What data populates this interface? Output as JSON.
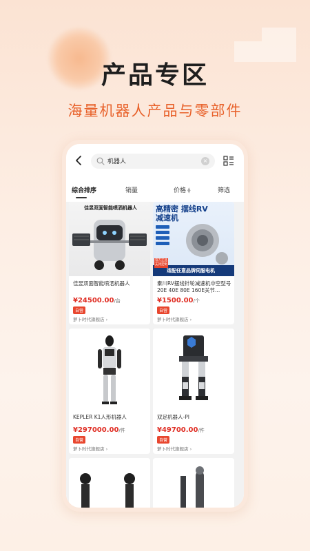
{
  "promo": {
    "title": "产品专区",
    "subtitle": "海量机器人产品与零部件"
  },
  "search": {
    "value": "机器人"
  },
  "sort_tabs": [
    "综合排序",
    "销量",
    "价格",
    "筛选"
  ],
  "products": [
    {
      "name": "佳昱双面智能喷洒机器人",
      "price": "¥24500.00",
      "unit": "/台",
      "badge": "自营",
      "store": "萝卜时代旗舰店 ›",
      "image_caption": "佳昱双面智能喷洒机器人"
    },
    {
      "name": "秦川RV摆线针轮减速机中空型号20E 40E 80E 160E关节...",
      "price": "¥1500.00",
      "unit": "/个",
      "badge": "自营",
      "store": "萝卜时代旗舰店 ›",
      "image_caption": "高精密 摆线RV减速机",
      "image_banner": "适配任意品牌伺服电机",
      "image_tag": "官方正品 支持定制"
    },
    {
      "name": "KEPLER K1人形机器人",
      "price": "¥297000.00",
      "unit": "/件",
      "badge": "自营",
      "store": "萝卜时代旗舰店 ›"
    },
    {
      "name": "双足机器人-PI",
      "price": "¥49700.00",
      "unit": "/件",
      "badge": "自营",
      "store": "萝卜时代旗舰店 ›"
    }
  ],
  "colors": {
    "accent": "#e8612a",
    "price": "#e02e24"
  }
}
